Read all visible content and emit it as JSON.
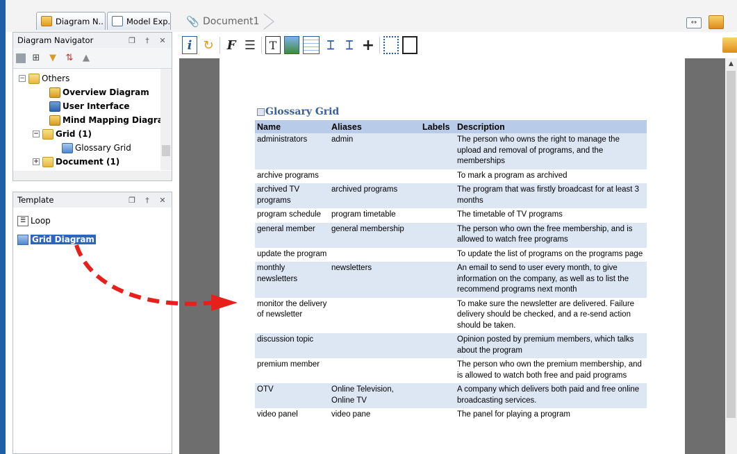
{
  "tabs": {
    "diagram_navigator": "Diagram N..",
    "model_explorer": "Model Exp..",
    "document": "Document1"
  },
  "diagram_navigator": {
    "title": "Diagram Navigator",
    "tree": [
      {
        "label": "Others",
        "bold": false,
        "icon": "folder-icon",
        "expander": "-",
        "level": 0
      },
      {
        "label": "Overview Diagram",
        "bold": true,
        "icon": "overview-diagram-icon",
        "expander": "",
        "level": 2
      },
      {
        "label": "User Interface",
        "bold": true,
        "icon": "user-interface-icon",
        "expander": "",
        "level": 2
      },
      {
        "label": "Mind Mapping Diagram",
        "bold": true,
        "icon": "mind-mapping-icon",
        "expander": "",
        "level": 2
      },
      {
        "label": "Grid (1)",
        "bold": true,
        "icon": "folder-icon",
        "expander": "-",
        "level": 1
      },
      {
        "label": "Glossary Grid",
        "bold": false,
        "icon": "grid-diagram-icon",
        "expander": "",
        "level": 3
      },
      {
        "label": "Document (1)",
        "bold": true,
        "icon": "folder-icon",
        "expander": "+",
        "level": 1
      }
    ]
  },
  "template_panel": {
    "title": "Template",
    "items": [
      {
        "label": "Loop",
        "icon": "loop-icon",
        "selected": false
      },
      {
        "label": "Grid Diagram",
        "icon": "grid-diagram-icon",
        "selected": true
      }
    ]
  },
  "glossary": {
    "title": "Glossary Grid",
    "headers": [
      "Name",
      "Aliases",
      "Labels",
      "Description"
    ],
    "rows": [
      {
        "name": "administrators",
        "aliases": "admin",
        "labels": "",
        "description": "The person who owns the right to manage the upload and removal of programs, and the memberships"
      },
      {
        "name": "archive programs",
        "aliases": "",
        "labels": "",
        "description": "To mark a program as archived"
      },
      {
        "name": "archived TV programs",
        "aliases": "archived programs",
        "labels": "",
        "description": "The program that was firstly broadcast for at least 3 months"
      },
      {
        "name": "program schedule",
        "aliases": "program timetable",
        "labels": "",
        "description": "The timetable of TV programs"
      },
      {
        "name": "general member",
        "aliases": "general membership",
        "labels": "",
        "description": "The person who own the free membership, and is allowed to watch free programs"
      },
      {
        "name": "update the program",
        "aliases": "",
        "labels": "",
        "description": "To update the list of programs on the programs page"
      },
      {
        "name": "monthly newsletters",
        "aliases": "newsletters",
        "labels": "",
        "description": "An email to send to user every month, to give information on the company, as well as to list the recommend programs next month"
      },
      {
        "name": "monitor the delivery of newsletter",
        "aliases": "",
        "labels": "",
        "description": "To make sure the newsletter are delivered. Failure delivery should be checked, and a re-send action should be taken."
      },
      {
        "name": "discussion topic",
        "aliases": "",
        "labels": "",
        "description": "Opinion posted by premium members, which talks about the program"
      },
      {
        "name": "premium member",
        "aliases": "",
        "labels": "",
        "description": "The person who own the premium membership, and is allowed to watch both free and paid programs"
      },
      {
        "name": "OTV",
        "aliases": "Online Television, Online TV",
        "labels": "",
        "description": "A company which delivers both paid and free online broadcasting services."
      },
      {
        "name": "video panel",
        "aliases": "video pane",
        "labels": "",
        "description": "The panel for playing a program"
      }
    ]
  },
  "colors": {
    "accent": "#2a66c0",
    "table_header": "#b8ccea",
    "table_row_alt": "#dde6f3",
    "arrow": "#e8201c",
    "canvas": "#6e6e6e",
    "glossary_title": "#3a5f9b"
  }
}
